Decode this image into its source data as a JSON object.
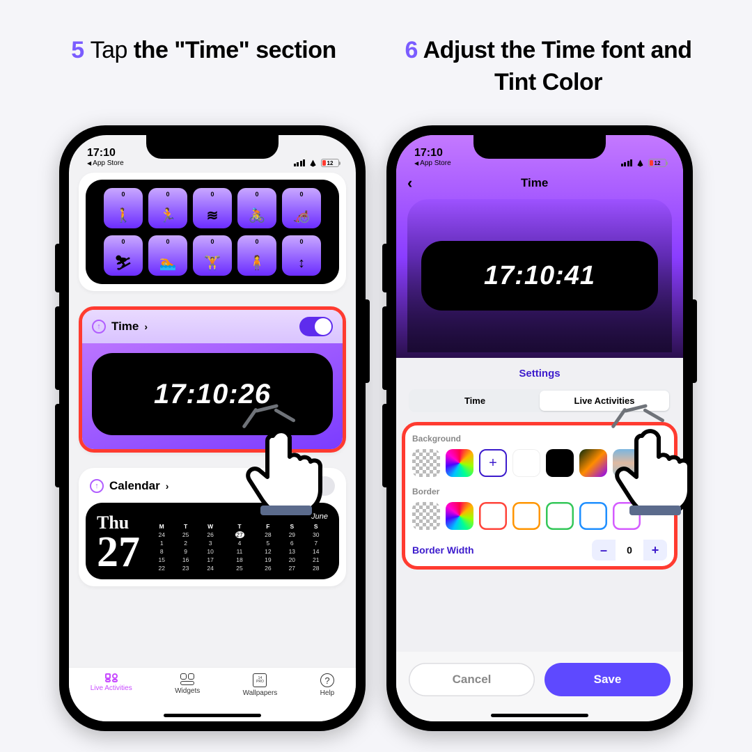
{
  "step5": {
    "num": "5",
    "verb": "Tap",
    "rest": "the \"Time\" section"
  },
  "step6": {
    "num": "6",
    "text": "Adjust the Time font and Tint Color"
  },
  "status": {
    "time": "17:10",
    "back": "App Store",
    "battery": "12"
  },
  "phone1": {
    "activity_zeros": [
      "0",
      "0",
      "0",
      "0",
      "0",
      "0",
      "0",
      "0",
      "0",
      "0"
    ],
    "activity_glyphs": [
      "🚶",
      "🏃",
      "≋",
      "🚴",
      "🦽",
      "⛷",
      "🏊",
      "🏋",
      "🧍",
      "↕"
    ],
    "time_label": "Time",
    "time_value": "17:10:26",
    "calendar_label": "Calendar",
    "calendar": {
      "dow": "Thu",
      "day": "27",
      "month": "June",
      "heads": [
        "M",
        "T",
        "W",
        "T",
        "F",
        "S",
        "S"
      ],
      "rows": [
        [
          "24",
          "25",
          "26",
          "27",
          "28",
          "29",
          "30"
        ],
        [
          "1",
          "2",
          "3",
          "4",
          "5",
          "6",
          "7"
        ],
        [
          "8",
          "9",
          "10",
          "11",
          "12",
          "13",
          "14"
        ],
        [
          "15",
          "16",
          "17",
          "18",
          "19",
          "20",
          "21"
        ],
        [
          "22",
          "23",
          "24",
          "25",
          "26",
          "27",
          "28"
        ]
      ]
    },
    "tabs": {
      "live": "Live Activities",
      "widgets": "Widgets",
      "wall": "Wallpapers",
      "wall_num": "14",
      "wall_sub": "PRO",
      "help": "Help"
    }
  },
  "phone2": {
    "title": "Time",
    "preview_time": "17:10:41",
    "settings": "Settings",
    "seg_time": "Time",
    "seg_live": "Live Activities",
    "bg_label": "Background",
    "border_label": "Border",
    "border_width_label": "Border Width",
    "border_width_value": "0",
    "plus": "+",
    "minus": "–",
    "cancel": "Cancel",
    "save": "Save"
  }
}
